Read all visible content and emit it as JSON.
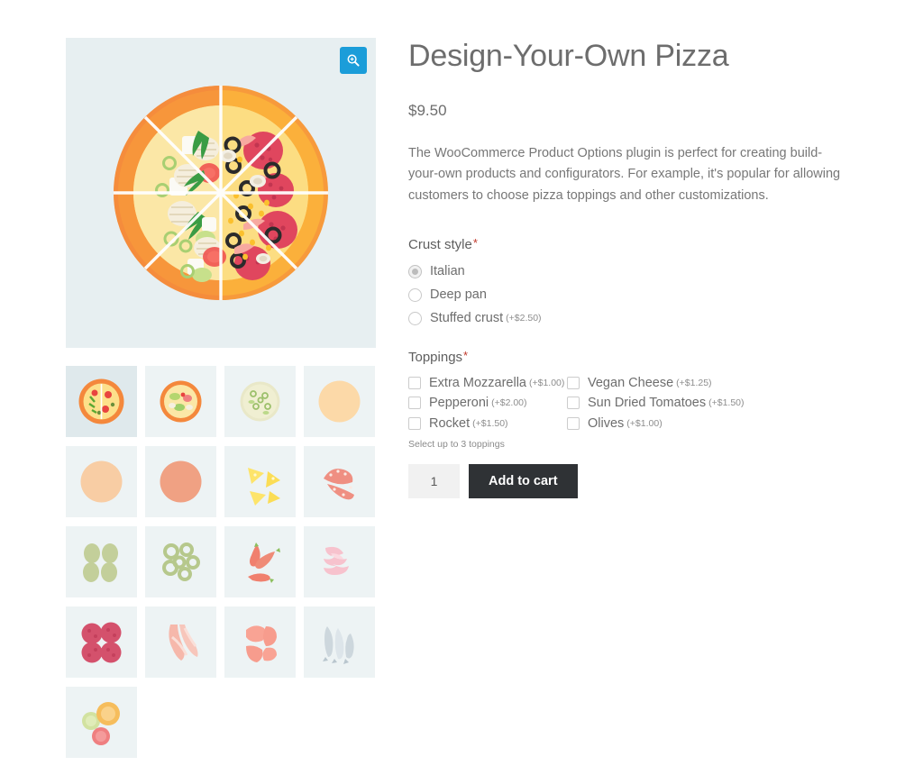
{
  "product": {
    "title": "Design-Your-Own Pizza",
    "price": "$9.50",
    "description": "The WooCommerce Product Options plugin is perfect for creating build-your-own products and configurators. For example, it's popular for allowing customers to choose pizza toppings and other customizations."
  },
  "gallery": {
    "zoom_button_label": "zoom-icon",
    "main_image_alt": "sliced-pizza-illustration",
    "background_color": "#e7eff1",
    "accent_color": "#1b9dd9",
    "thumbnails": [
      {
        "name": "whole-pizza",
        "active": true
      },
      {
        "name": "veggie-pizza",
        "active": false
      },
      {
        "name": "white-pizza",
        "active": false
      },
      {
        "name": "plain-dough-base",
        "active": false
      },
      {
        "name": "pizza-base",
        "active": false
      },
      {
        "name": "tomato-sauce-base",
        "active": false
      },
      {
        "name": "cheese-slices",
        "active": false
      },
      {
        "name": "mushrooms",
        "active": false
      },
      {
        "name": "green-olives-whole",
        "active": false
      },
      {
        "name": "olive-rings",
        "active": false
      },
      {
        "name": "chili-peppers",
        "active": false
      },
      {
        "name": "prosciutto-ham",
        "active": false
      },
      {
        "name": "salami-slices",
        "active": false
      },
      {
        "name": "bacon-strips",
        "active": false
      },
      {
        "name": "ham-slices",
        "active": false
      },
      {
        "name": "anchovies",
        "active": false
      },
      {
        "name": "sliced-vegetables",
        "active": false
      }
    ]
  },
  "options": {
    "required_marker": "*",
    "required_color": "#c0392b",
    "crust": {
      "label": "Crust style",
      "choices": [
        {
          "label": "Italian",
          "price": "",
          "selected": true
        },
        {
          "label": "Deep pan",
          "price": "",
          "selected": false
        },
        {
          "label": "Stuffed crust",
          "price": "(+$2.50)",
          "selected": false
        }
      ]
    },
    "toppings": {
      "label": "Toppings",
      "helper": "Select up to 3 toppings",
      "left_column": [
        {
          "label": "Extra Mozzarella",
          "price": "(+$1.00)",
          "checked": false
        },
        {
          "label": "Pepperoni",
          "price": "(+$2.00)",
          "checked": false
        },
        {
          "label": "Rocket",
          "price": "(+$1.50)",
          "checked": false
        }
      ],
      "right_column": [
        {
          "label": "Vegan Cheese",
          "price": "(+$1.25)",
          "checked": false
        },
        {
          "label": "Sun Dried Tomatoes",
          "price": "(+$1.50)",
          "checked": false
        },
        {
          "label": "Olives",
          "price": "(+$1.00)",
          "checked": false
        }
      ]
    }
  },
  "cart": {
    "quantity_value": "1",
    "quantity_placeholder": "1",
    "add_to_cart_label": "Add to cart",
    "button_color": "#2f3235"
  }
}
